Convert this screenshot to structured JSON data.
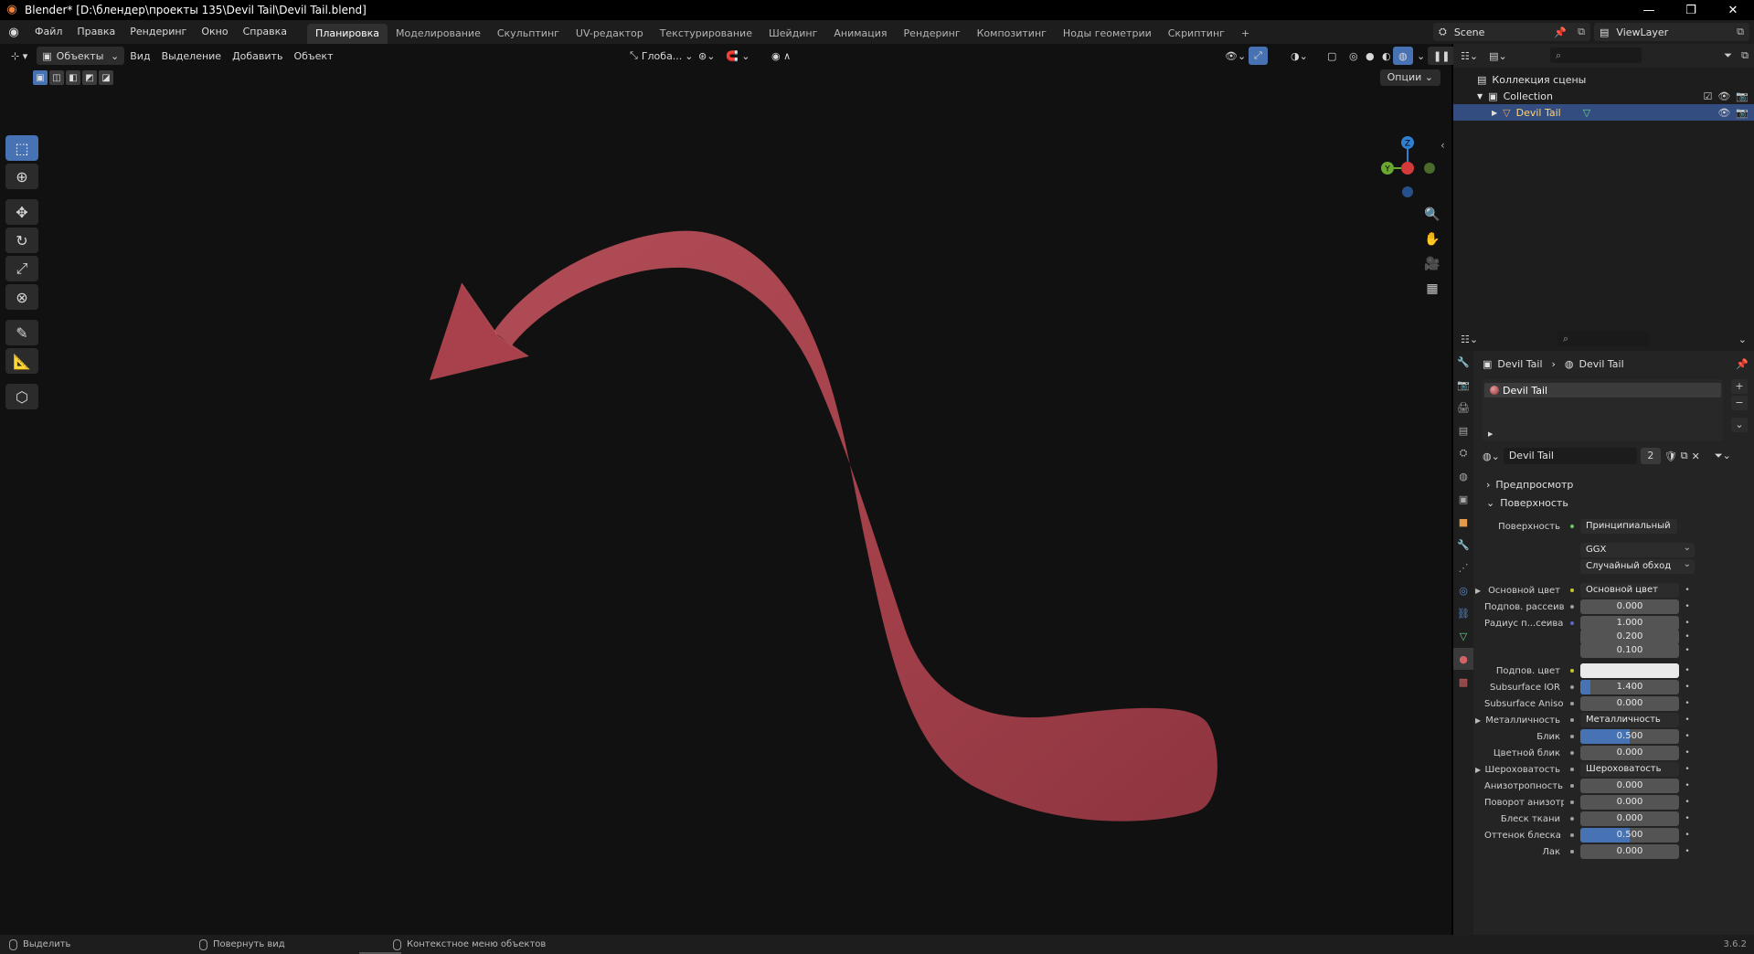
{
  "titlebar": {
    "title": "Blender* [D:\\блендер\\проекты 135\\Devil Tail\\Devil Tail.blend]",
    "minimize": "—",
    "maximize": "❐",
    "close": "✕"
  },
  "menu": {
    "items": [
      "Файл",
      "Правка",
      "Рендеринг",
      "Окно",
      "Справка"
    ]
  },
  "workspaces": {
    "tabs": [
      "Планировка",
      "Моделирование",
      "Скульптинг",
      "UV-редактор",
      "Текстурирование",
      "Шейдинг",
      "Анимация",
      "Рендеринг",
      "Композитинг",
      "Ноды геометрии",
      "Скриптинг"
    ],
    "add": "+",
    "active_index": 0
  },
  "scene": {
    "name": "Scene",
    "view_layer": "ViewLayer"
  },
  "viewport": {
    "mode": "Объекты",
    "menus": [
      "Вид",
      "Выделение",
      "Добавить",
      "Объект"
    ],
    "orientation": "Глоба...",
    "options": "Опции",
    "gizmo": {
      "z": "Z",
      "y": "Y"
    },
    "object_color": "#a8414b",
    "background_color": "#111111"
  },
  "toolbar": {
    "tools": [
      "select-box-icon",
      "cursor-icon",
      "move-icon",
      "rotate-icon",
      "scale-icon",
      "transform-icon",
      "annotate-icon",
      "measure-icon",
      "add-cube-icon"
    ]
  },
  "outliner": {
    "root": "Коллекция сцены",
    "collection": "Collection",
    "object": "Devil Tail"
  },
  "properties": {
    "breadcrumb_object": "Devil Tail",
    "breadcrumb_material": "Devil Tail",
    "slot": "Devil Tail",
    "material_name": "Devil Tail",
    "users": "2",
    "preview_panel": "Предпросмотр",
    "surface_panel": "Поверхность",
    "surface_label": "Поверхность",
    "surface_value": "Принципиальный BSDF",
    "distribution": "GGX",
    "subsurface_method": "Случайный обход",
    "rows": [
      {
        "label": "Основной цвет",
        "value": "Основной цвет",
        "kind": "link",
        "socket": "yellow",
        "arrow": true
      },
      {
        "label": "Подпов. рассеива...",
        "value": "0.000",
        "kind": "num",
        "socket": "grey"
      },
      {
        "label": "Радиус п...сеивания",
        "value": "1.000",
        "kind": "num",
        "socket": "purple"
      },
      {
        "label": "",
        "value": "0.200",
        "kind": "num",
        "socket": "none"
      },
      {
        "label": "",
        "value": "0.100",
        "kind": "num",
        "socket": "none"
      },
      {
        "label": "Подпов. цвет",
        "value": "",
        "kind": "color",
        "socket": "yellow"
      },
      {
        "label": "Subsurface IOR",
        "value": "1.400",
        "kind": "bar",
        "fill": 0.1,
        "socket": "grey"
      },
      {
        "label": "Subsurface Anisotr...",
        "value": "0.000",
        "kind": "num",
        "socket": "grey"
      },
      {
        "label": "Металличность",
        "value": "Металличность",
        "kind": "link",
        "socket": "grey",
        "arrow": true
      },
      {
        "label": "Блик",
        "value": "0.500",
        "kind": "bar",
        "fill": 0.5,
        "socket": "grey"
      },
      {
        "label": "Цветной блик",
        "value": "0.000",
        "kind": "num",
        "socket": "grey"
      },
      {
        "label": "Шероховатость",
        "value": "Шероховатость",
        "kind": "link",
        "socket": "grey",
        "arrow": true
      },
      {
        "label": "Анизотропность",
        "value": "0.000",
        "kind": "num",
        "socket": "grey"
      },
      {
        "label": "Поворот анизотро...",
        "value": "0.000",
        "kind": "num",
        "socket": "grey"
      },
      {
        "label": "Блеск ткани",
        "value": "0.000",
        "kind": "num",
        "socket": "grey"
      },
      {
        "label": "Оттенок блеска тк...",
        "value": "0.500",
        "kind": "bar",
        "fill": 0.5,
        "socket": "grey"
      },
      {
        "label": "Лак",
        "value": "0.000",
        "kind": "num",
        "socket": "grey"
      }
    ]
  },
  "statusbar": {
    "select": "Выделить",
    "rotate": "Повернуть вид",
    "context": "Контекстное меню объектов",
    "version": "3.6.2"
  }
}
